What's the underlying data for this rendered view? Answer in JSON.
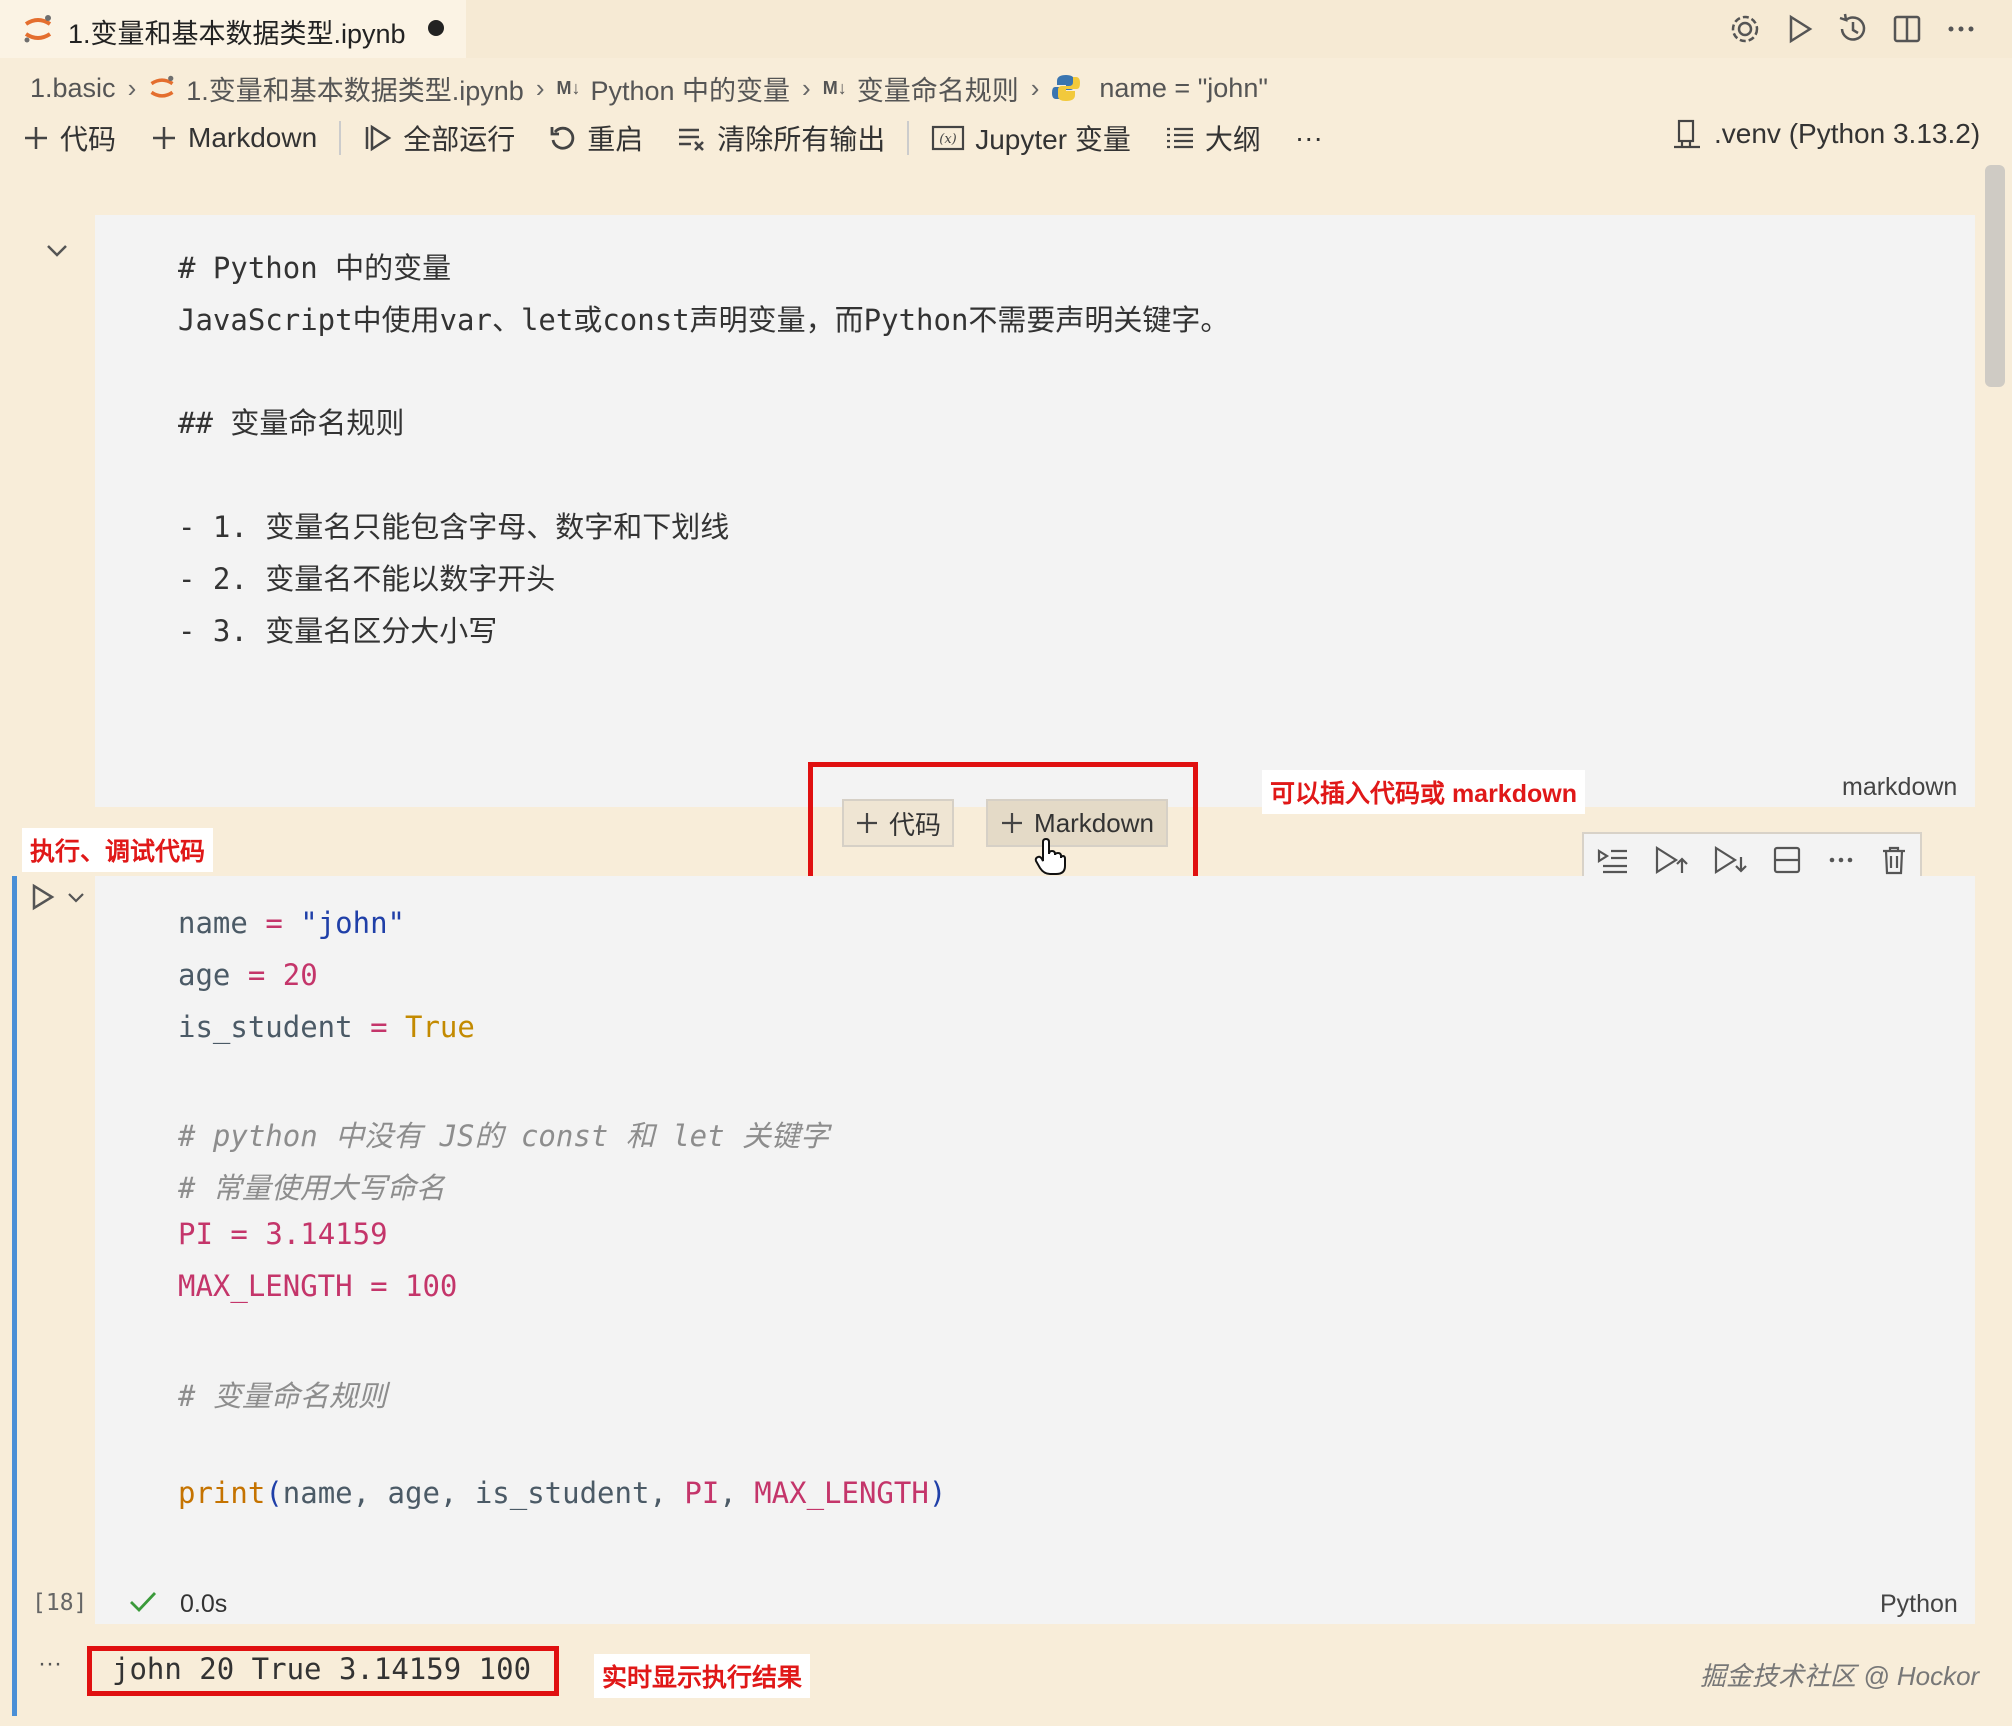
{
  "tab": {
    "title": "1.变量和基本数据类型.ipynb"
  },
  "breadcrumb": {
    "folder": "1.basic",
    "file": "1.变量和基本数据类型.ipynb",
    "md_badge": "M↓",
    "section1": "Python 中的变量",
    "section2": "变量命名规则",
    "symbol": "name = \"john\""
  },
  "toolbar": {
    "add_code": "代码",
    "add_markdown": "Markdown",
    "run_all": "全部运行",
    "restart": "重启",
    "clear_outputs": "清除所有输出",
    "variables": "Jupyter 变量",
    "outline": "大纲",
    "more": "···",
    "kernel": ".venv (Python 3.13.2)"
  },
  "markdown_cell": {
    "lines": [
      "# Python 中的变量",
      "JavaScript中使用var、let或const声明变量，而Python不需要声明关键字。",
      "## 变量命名规则",
      "- 1. 变量名只能包含字母、数字和下划线",
      "- 2. 变量名不能以数字开头",
      "- 3. 变量名区分大小写"
    ],
    "language": "markdown"
  },
  "insert": {
    "code_label": "代码",
    "markdown_label": "Markdown"
  },
  "annotations": {
    "insert_note": "可以插入代码或 markdown",
    "run_note": "执行、调试代码",
    "output_note": "实时显示执行结果"
  },
  "code_cell": {
    "l1": {
      "name": "name",
      "eq": "=",
      "val": "\"john\""
    },
    "l2": {
      "name": "age",
      "eq": "=",
      "val": "20"
    },
    "l3": {
      "name": "is_student",
      "eq": "=",
      "val": "True"
    },
    "c1": "# python 中没有 JS的 const 和 let 关键字",
    "c2": "# 常量使用大写命名",
    "l4": {
      "name": "PI",
      "eq": "=",
      "val": "3.14159"
    },
    "l5": {
      "name": "MAX_LENGTH",
      "eq": "=",
      "val": "100"
    },
    "c3": "# 变量命名规则",
    "print": {
      "fn": "print",
      "open": "(",
      "a1": "name, age, is_student, ",
      "a2": "PI",
      "comma": ", ",
      "a3": "MAX_LENGTH",
      "close": ")"
    },
    "exec_count": "[18]",
    "duration": "0.0s",
    "language": "Python"
  },
  "output": {
    "ellipsis": "···",
    "text": "john 20 True 3.14159 100"
  },
  "watermark": "掘金技术社区 @ Hockor"
}
